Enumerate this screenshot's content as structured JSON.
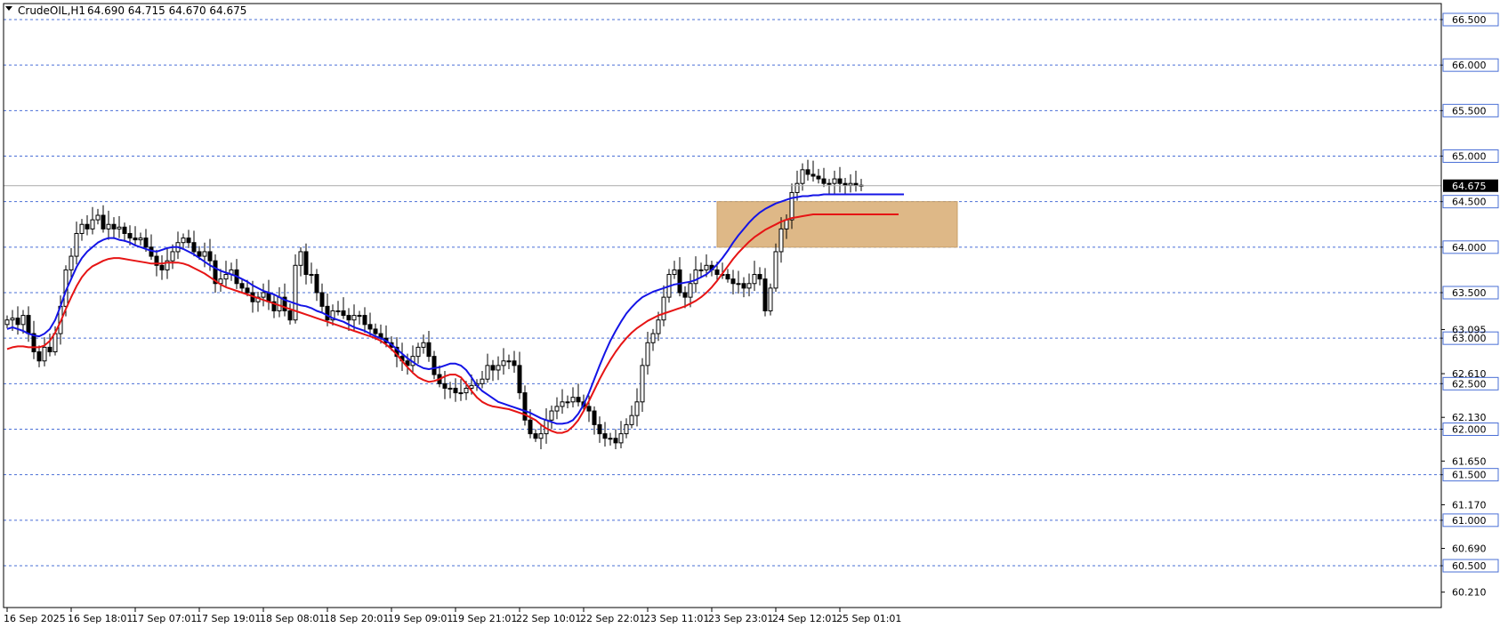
{
  "header": {
    "symbol": "CrudeOIL,H1",
    "ohlc": "64.690 64.715 64.670 64.675"
  },
  "colors": {
    "candle_body_bull": "#ffffff",
    "candle_body_bear": "#000000",
    "candle_outline": "#000000",
    "ma_fast": "#1414e6",
    "ma_slow": "#e61414",
    "zone_fill": "#deb887",
    "grid": "#4a6fd6",
    "price_line": "#a9a9a9",
    "badge_bg": "#000000",
    "badge_text": "#ffffff",
    "axis_text": "#000000"
  },
  "chart_data": {
    "type": "candlestick",
    "timeframe": "H1",
    "instrument": "CrudeOIL",
    "ylim": [
      60.05,
      66.6
    ],
    "current_price": 64.675,
    "current_price_label": "64.675",
    "y_ticks": [
      {
        "value": 66.5,
        "label": "66.500",
        "dashed": true,
        "boxed": true
      },
      {
        "value": 66.0,
        "label": "66.000",
        "dashed": true,
        "boxed": true
      },
      {
        "value": 65.5,
        "label": "65.500",
        "dashed": true,
        "boxed": true
      },
      {
        "value": 65.0,
        "label": "65.000",
        "dashed": true,
        "boxed": true
      },
      {
        "value": 64.5,
        "label": "64.500",
        "dashed": true,
        "boxed": true
      },
      {
        "value": 64.0,
        "label": "64.000",
        "dashed": true,
        "boxed": true
      },
      {
        "value": 63.5,
        "label": "63.500",
        "dashed": true,
        "boxed": true
      },
      {
        "value": 63.0,
        "label": "63.000",
        "dashed": true,
        "boxed": true
      },
      {
        "value": 62.5,
        "label": "62.500",
        "dashed": true,
        "boxed": true
      },
      {
        "value": 62.0,
        "label": "62.000",
        "dashed": true,
        "boxed": true
      },
      {
        "value": 61.5,
        "label": "61.500",
        "dashed": true,
        "boxed": true
      },
      {
        "value": 61.0,
        "label": "61.000",
        "dashed": true,
        "boxed": true
      },
      {
        "value": 60.5,
        "label": "60.500",
        "dashed": true,
        "boxed": true
      },
      {
        "value": 63.095,
        "label": "63.095",
        "dashed": false,
        "boxed": false
      },
      {
        "value": 62.61,
        "label": "62.610",
        "dashed": false,
        "boxed": false
      },
      {
        "value": 62.13,
        "label": "62.130",
        "dashed": false,
        "boxed": false
      },
      {
        "value": 61.65,
        "label": "61.650",
        "dashed": false,
        "boxed": false
      },
      {
        "value": 61.17,
        "label": "61.170",
        "dashed": false,
        "boxed": false
      },
      {
        "value": 60.69,
        "label": "60.690",
        "dashed": false,
        "boxed": false
      },
      {
        "value": 60.21,
        "label": "60.210",
        "dashed": false,
        "boxed": false
      }
    ],
    "x_labels": [
      {
        "index": 0,
        "label": "16 Sep 2025"
      },
      {
        "index": 12,
        "label": "16 Sep 18:01"
      },
      {
        "index": 24,
        "label": "17 Sep 07:01"
      },
      {
        "index": 36,
        "label": "17 Sep 19:01"
      },
      {
        "index": 48,
        "label": "18 Sep 08:01"
      },
      {
        "index": 60,
        "label": "18 Sep 20:01"
      },
      {
        "index": 72,
        "label": "19 Sep 09:01"
      },
      {
        "index": 84,
        "label": "19 Sep 21:01"
      },
      {
        "index": 96,
        "label": "22 Sep 10:01"
      },
      {
        "index": 108,
        "label": "22 Sep 22:01"
      },
      {
        "index": 120,
        "label": "23 Sep 11:01"
      },
      {
        "index": 132,
        "label": "23 Sep 23:01"
      },
      {
        "index": 144,
        "label": "24 Sep 12:01"
      },
      {
        "index": 156,
        "label": "25 Sep 01:01"
      }
    ],
    "zone": {
      "from_index": 133,
      "to_index": 178,
      "low": 64.0,
      "high": 64.5
    },
    "closes": [
      63.2,
      63.22,
      63.15,
      63.25,
      63.05,
      62.85,
      62.75,
      62.9,
      62.85,
      63.05,
      63.35,
      63.75,
      63.9,
      64.15,
      64.25,
      64.2,
      64.3,
      64.35,
      64.2,
      64.25,
      64.2,
      64.22,
      64.15,
      64.1,
      64.08,
      64.1,
      64.0,
      63.9,
      63.8,
      63.75,
      63.85,
      63.95,
      64.05,
      64.1,
      64.05,
      63.95,
      63.9,
      63.95,
      63.85,
      63.6,
      63.65,
      63.7,
      63.75,
      63.6,
      63.55,
      63.5,
      63.4,
      63.45,
      63.5,
      63.4,
      63.3,
      63.45,
      63.3,
      63.2,
      63.8,
      63.95,
      63.7,
      63.7,
      63.5,
      63.35,
      63.2,
      63.3,
      63.3,
      63.25,
      63.2,
      63.25,
      63.25,
      63.15,
      63.1,
      63.05,
      63.0,
      62.95,
      62.9,
      62.8,
      62.75,
      62.7,
      62.8,
      62.9,
      62.95,
      62.8,
      62.6,
      62.5,
      62.45,
      62.45,
      62.4,
      62.4,
      62.45,
      62.48,
      62.5,
      62.55,
      62.7,
      62.65,
      62.7,
      62.75,
      62.75,
      62.7,
      62.4,
      62.1,
      61.95,
      61.9,
      61.95,
      62.1,
      62.2,
      62.25,
      62.3,
      62.3,
      62.35,
      62.3,
      62.25,
      62.2,
      62.05,
      61.95,
      61.9,
      61.9,
      61.85,
      61.95,
      62.05,
      62.15,
      62.3,
      62.7,
      62.95,
      63.05,
      63.2,
      63.45,
      63.7,
      63.75,
      63.5,
      63.45,
      63.6,
      63.75,
      63.75,
      63.8,
      63.75,
      63.7,
      63.7,
      63.65,
      63.6,
      63.6,
      63.55,
      63.6,
      63.7,
      63.65,
      63.3,
      63.55,
      63.95,
      64.2,
      64.3,
      64.6,
      64.7,
      64.85,
      64.8,
      64.78,
      64.75,
      64.7,
      64.7,
      64.75,
      64.7,
      64.68,
      64.7,
      64.68,
      64.675
    ],
    "series": [
      {
        "name": "",
        "role": "fast moving average",
        "color": "#1414e6",
        "start_index": 0,
        "values": [
          63.1,
          63.12,
          63.1,
          63.08,
          63.05,
          63.03,
          63.02,
          63.05,
          63.1,
          63.2,
          63.35,
          63.52,
          63.65,
          63.78,
          63.88,
          63.95,
          64.0,
          64.05,
          64.08,
          64.1,
          64.1,
          64.08,
          64.07,
          64.05,
          64.02,
          64.0,
          63.98,
          63.96,
          63.95,
          63.97,
          63.99,
          64.0,
          64.0,
          63.98,
          63.95,
          63.92,
          63.88,
          63.84,
          63.8,
          63.77,
          63.74,
          63.72,
          63.7,
          63.68,
          63.65,
          63.62,
          63.58,
          63.55,
          63.52,
          63.5,
          63.48,
          63.45,
          63.42,
          63.4,
          63.38,
          63.36,
          63.35,
          63.33,
          63.3,
          63.28,
          63.25,
          63.22,
          63.2,
          63.18,
          63.15,
          63.12,
          63.1,
          63.08,
          63.05,
          63.02,
          63.0,
          62.97,
          62.93,
          62.88,
          62.83,
          62.78,
          62.74,
          62.7,
          62.67,
          62.66,
          62.67,
          62.68,
          62.7,
          62.72,
          62.72,
          62.7,
          62.65,
          62.57,
          62.48,
          62.42,
          62.38,
          62.34,
          62.3,
          62.28,
          62.26,
          62.24,
          62.22,
          62.2,
          62.18,
          62.15,
          62.12,
          62.1,
          62.08,
          62.06,
          62.06,
          62.07,
          62.1,
          62.17,
          62.27,
          62.4,
          62.55,
          62.7,
          62.84,
          62.97,
          63.08,
          63.18,
          63.27,
          63.34,
          63.4,
          63.45,
          63.48,
          63.51,
          63.53,
          63.55,
          63.57,
          63.59,
          63.6,
          63.61,
          63.62,
          63.64,
          63.67,
          63.7,
          63.75,
          63.81,
          63.88,
          63.96,
          64.05,
          64.13,
          64.2,
          64.27,
          64.33,
          64.38,
          64.42,
          64.45,
          64.48,
          64.5,
          64.52,
          64.54,
          64.55,
          64.56,
          64.56,
          64.57,
          64.57,
          64.58,
          64.58,
          64.58,
          64.58,
          64.58,
          64.58,
          64.58,
          64.58,
          64.58,
          64.58,
          64.58,
          64.58,
          64.58,
          64.58,
          64.58,
          64.58
        ]
      },
      {
        "name": "",
        "role": "slow moving average",
        "color": "#e61414",
        "start_index": 0,
        "values": [
          62.88,
          62.9,
          62.91,
          62.91,
          62.9,
          62.9,
          62.9,
          62.92,
          62.97,
          63.06,
          63.18,
          63.32,
          63.45,
          63.57,
          63.67,
          63.74,
          63.79,
          63.82,
          63.85,
          63.87,
          63.88,
          63.88,
          63.87,
          63.86,
          63.85,
          63.84,
          63.83,
          63.82,
          63.82,
          63.82,
          63.83,
          63.83,
          63.83,
          63.82,
          63.8,
          63.77,
          63.74,
          63.71,
          63.67,
          63.63,
          63.59,
          63.56,
          63.54,
          63.52,
          63.5,
          63.48,
          63.46,
          63.44,
          63.42,
          63.4,
          63.38,
          63.36,
          63.34,
          63.32,
          63.3,
          63.28,
          63.26,
          63.24,
          63.22,
          63.2,
          63.18,
          63.16,
          63.14,
          63.12,
          63.1,
          63.08,
          63.06,
          63.04,
          63.02,
          63.0,
          62.97,
          62.93,
          62.88,
          62.82,
          62.75,
          62.68,
          62.62,
          62.57,
          62.54,
          62.52,
          62.53,
          62.55,
          62.58,
          62.6,
          62.6,
          62.57,
          62.5,
          62.42,
          62.35,
          62.3,
          62.27,
          62.25,
          62.24,
          62.23,
          62.22,
          62.2,
          62.18,
          62.16,
          62.13,
          62.1,
          62.05,
          62.01,
          61.98,
          61.96,
          61.96,
          61.98,
          62.03,
          62.1,
          62.2,
          62.31,
          62.43,
          62.55,
          62.66,
          62.76,
          62.85,
          62.93,
          63.0,
          63.06,
          63.11,
          63.15,
          63.19,
          63.22,
          63.25,
          63.27,
          63.29,
          63.31,
          63.33,
          63.35,
          63.38,
          63.41,
          63.45,
          63.5,
          63.56,
          63.63,
          63.71,
          63.79,
          63.87,
          63.94,
          64.0,
          64.06,
          64.11,
          64.15,
          64.19,
          64.22,
          64.25,
          64.28,
          64.3,
          64.32,
          64.33,
          64.34,
          64.35,
          64.36,
          64.36,
          64.36,
          64.36,
          64.36,
          64.36,
          64.36,
          64.36,
          64.36,
          64.36,
          64.36,
          64.36,
          64.36,
          64.36,
          64.36,
          64.36,
          64.36
        ]
      }
    ]
  }
}
